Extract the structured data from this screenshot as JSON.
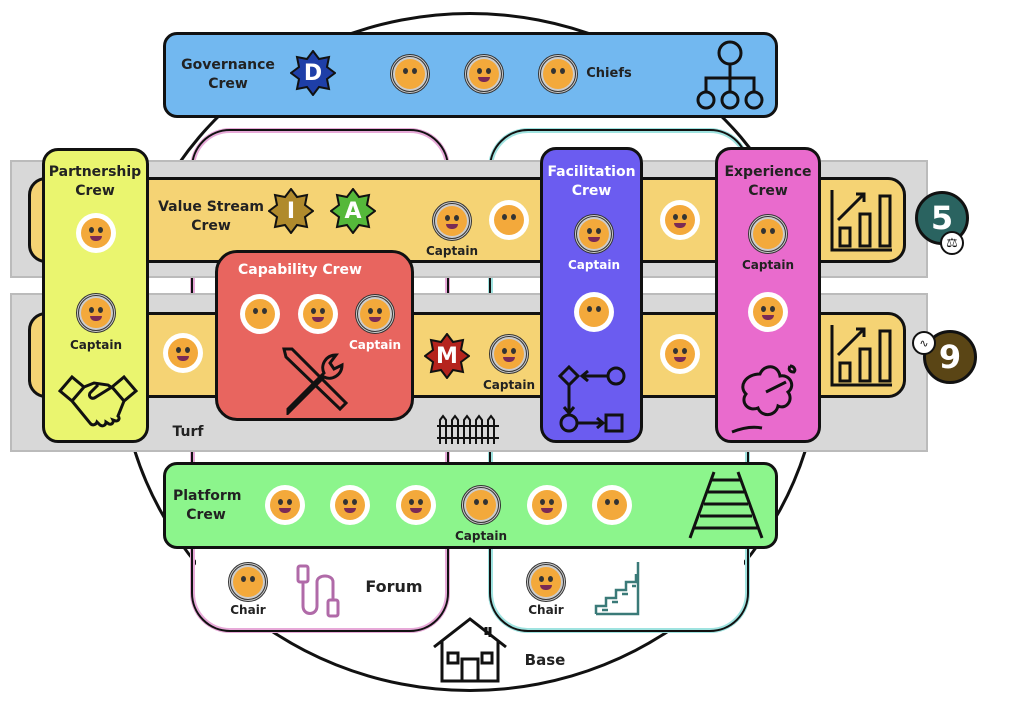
{
  "colors": {
    "governance": "#72b8f0",
    "value_stream": "#f5d374",
    "partnership": "#eaf56f",
    "capability": "#e8655f",
    "facilitation": "#6b5cf0",
    "experience": "#e96bcd",
    "platform": "#8cf58c",
    "turf": "#d8d8d8",
    "forum_outline": "#e7a9d8",
    "base_outline": "#9fe3e0",
    "badge_5": "#2a6360",
    "badge_9": "#5a4515"
  },
  "governance": {
    "title": "Governance Crew",
    "star_letter": "D",
    "star_color": "#1e3fa8",
    "role": "Chiefs",
    "icon": "org-chart-icon",
    "faces": [
      "face-with-rolling-eyes",
      "squinting-face-with-tongue",
      "relieved-face"
    ]
  },
  "value_stream": {
    "title": "Value Stream Crew",
    "stars": [
      {
        "letter": "I",
        "color": "#b08a2c"
      },
      {
        "letter": "A",
        "color": "#55b83a"
      }
    ],
    "captain": "Captain",
    "icon": "bar-chart-growth-icon"
  },
  "value_stream_2": {
    "star_letter": "M",
    "star_color": "#b5231d",
    "captain": "Captain",
    "icon": "bar-chart-growth-icon"
  },
  "partnership": {
    "title": "Partnership Crew",
    "captain": "Captain",
    "icon": "handshake-icon"
  },
  "capability": {
    "title": "Capability Crew",
    "captain": "Captain",
    "icon": "tools-icon"
  },
  "facilitation": {
    "title": "Facilitation Crew",
    "captain": "Captain",
    "icon": "flow-diagram-icon"
  },
  "experience": {
    "title": "Experience Crew",
    "captain": "Captain",
    "icon": "hibiscus-icon"
  },
  "turf": {
    "label": "Turf",
    "icon": "fence-icon"
  },
  "platform": {
    "title": "Platform Crew",
    "captain": "Captain",
    "icon": "railway-track-icon"
  },
  "forum": {
    "label": "Forum",
    "chair": "Chair",
    "icon": "cable-icon"
  },
  "base_group": {
    "chair": "Chair",
    "icon": "stairs-icon"
  },
  "base": {
    "label": "Base",
    "icon": "house-icon"
  },
  "badges": [
    {
      "value": "5",
      "icon": "scales-icon"
    },
    {
      "value": "9",
      "icon": "heartbeat-icon"
    }
  ]
}
